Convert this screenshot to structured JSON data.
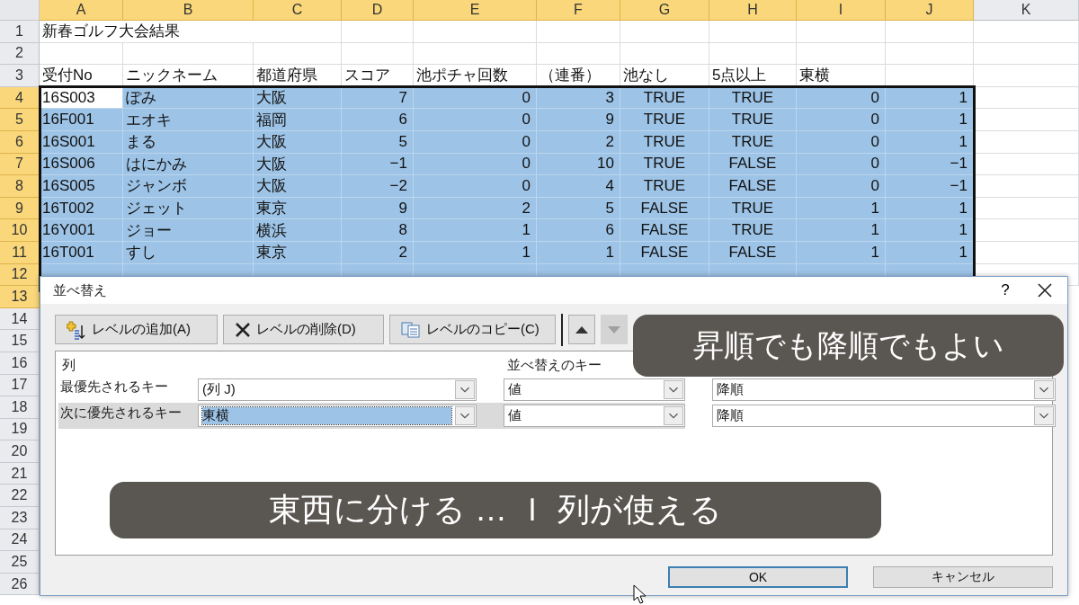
{
  "sheet": {
    "columns": [
      {
        "label": "A",
        "selected": true,
        "kind": "text"
      },
      {
        "label": "B",
        "selected": true,
        "kind": "text"
      },
      {
        "label": "C",
        "selected": true,
        "kind": "text"
      },
      {
        "label": "D",
        "selected": true,
        "kind": "number"
      },
      {
        "label": "E",
        "selected": true,
        "kind": "number"
      },
      {
        "label": "F",
        "selected": true,
        "kind": "number"
      },
      {
        "label": "G",
        "selected": true,
        "kind": "boolean"
      },
      {
        "label": "H",
        "selected": true,
        "kind": "boolean"
      },
      {
        "label": "I",
        "selected": true,
        "kind": "number"
      },
      {
        "label": "J",
        "selected": true,
        "kind": "number"
      },
      {
        "label": "K",
        "selected": false
      }
    ],
    "rows": [
      {
        "number": "1",
        "selected": false,
        "active": false,
        "cells": [
          "新春ゴルフ大会結果"
        ]
      },
      {
        "number": "2",
        "selected": false,
        "active": false,
        "cells": []
      },
      {
        "number": "3",
        "selected": false,
        "active": false,
        "cells": [
          "受付No",
          "ニックネーム",
          "都道府県",
          "スコア",
          "池ポチャ回数",
          "（連番）",
          "池なし",
          "5点以上",
          "東横"
        ]
      },
      {
        "number": "4",
        "selected": true,
        "active": true,
        "cells": [
          "16S003",
          "ぽみ",
          "大阪",
          "7",
          "0",
          "3",
          "TRUE",
          "TRUE",
          "0",
          "1"
        ]
      },
      {
        "number": "5",
        "selected": true,
        "active": false,
        "cells": [
          "16F001",
          "エオキ",
          "福岡",
          "6",
          "0",
          "9",
          "TRUE",
          "TRUE",
          "0",
          "1"
        ]
      },
      {
        "number": "6",
        "selected": true,
        "active": false,
        "cells": [
          "16S001",
          "まる",
          "大阪",
          "5",
          "0",
          "2",
          "TRUE",
          "TRUE",
          "0",
          "1"
        ]
      },
      {
        "number": "7",
        "selected": true,
        "active": false,
        "cells": [
          "16S006",
          "はにかみ",
          "大阪",
          "−1",
          "0",
          "10",
          "TRUE",
          "FALSE",
          "0",
          "−1"
        ]
      },
      {
        "number": "8",
        "selected": true,
        "active": false,
        "cells": [
          "16S005",
          "ジャンボ",
          "大阪",
          "−2",
          "0",
          "4",
          "TRUE",
          "FALSE",
          "0",
          "−1"
        ]
      },
      {
        "number": "9",
        "selected": true,
        "active": false,
        "cells": [
          "16T002",
          "ジェット",
          "東京",
          "9",
          "2",
          "5",
          "FALSE",
          "TRUE",
          "1",
          "1"
        ]
      },
      {
        "number": "10",
        "selected": true,
        "active": false,
        "cells": [
          "16Y001",
          "ジョー",
          "横浜",
          "8",
          "1",
          "6",
          "FALSE",
          "TRUE",
          "1",
          "1"
        ]
      },
      {
        "number": "11",
        "selected": true,
        "active": false,
        "cells": [
          "16T001",
          "すし",
          "東京",
          "2",
          "1",
          "1",
          "FALSE",
          "FALSE",
          "1",
          "1"
        ]
      },
      {
        "number": "12",
        "selected": true,
        "active": false,
        "cells": []
      },
      {
        "number": "13",
        "selected": true,
        "cells": []
      },
      {
        "number": "14",
        "selected": false,
        "cells": []
      },
      {
        "number": "15",
        "selected": false,
        "cells": []
      },
      {
        "number": "16",
        "selected": false,
        "cells": []
      },
      {
        "number": "17",
        "selected": false,
        "cells": []
      },
      {
        "number": "18",
        "selected": false,
        "cells": []
      },
      {
        "number": "19",
        "selected": false,
        "cells": []
      },
      {
        "number": "20",
        "selected": false,
        "cells": []
      },
      {
        "number": "21",
        "selected": false,
        "cells": []
      },
      {
        "number": "22",
        "selected": false,
        "cells": []
      },
      {
        "number": "23",
        "selected": false,
        "cells": []
      },
      {
        "number": "24",
        "selected": false,
        "cells": []
      },
      {
        "number": "25",
        "selected": false,
        "cells": []
      },
      {
        "number": "26",
        "selected": false,
        "cells": []
      }
    ]
  },
  "dialog": {
    "title": "並べ替え",
    "help": "?",
    "toolbar": [
      {
        "label": "レベルの追加(A)",
        "kind": "add"
      },
      {
        "label": "レベルの削除(D)",
        "kind": "delete"
      },
      {
        "label": "レベルのコピー(C)",
        "kind": "copy"
      }
    ],
    "move_buttons": [
      {
        "kind": "up",
        "disabled": false
      },
      {
        "kind": "down",
        "disabled": true
      }
    ],
    "headers": [
      "列",
      "並べ替えのキー"
    ],
    "levels": [
      {
        "label": "最優先されるキー",
        "column": "(列 J)",
        "key": "値",
        "order": "降順",
        "selected": false
      },
      {
        "label": "次に優先されるキー",
        "column": "東横",
        "key": "値",
        "order": "降順",
        "selected": true
      }
    ],
    "buttons": [
      {
        "label": "OK",
        "default": true
      },
      {
        "label": "キャンセル",
        "default": false
      }
    ]
  },
  "captions": [
    "昇順でも降順でもよい",
    "東西に分ける …  Ｉ 列が使える"
  ]
}
